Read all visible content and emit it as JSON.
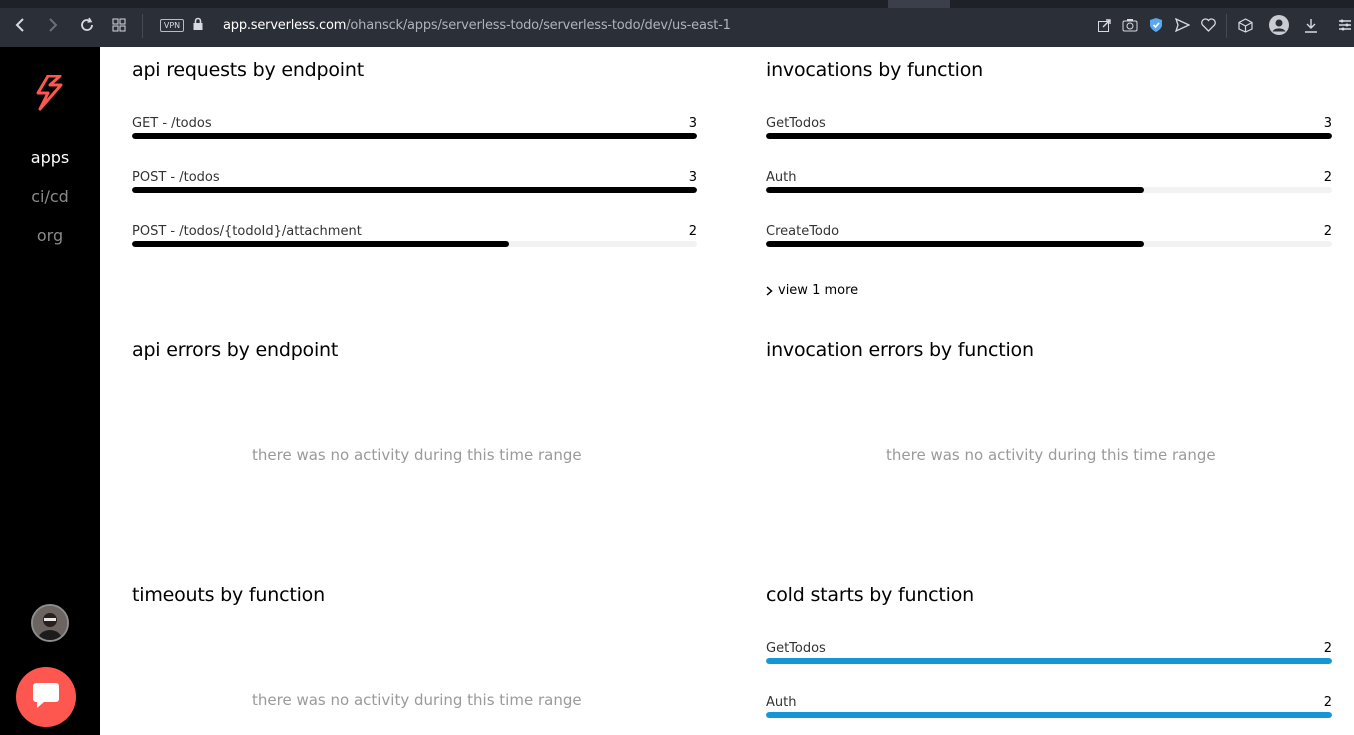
{
  "browser": {
    "vpn_label": "VPN",
    "url_host": "app.serverless.com",
    "url_path": "/ohansck/apps/serverless-todo/serverless-todo/dev/us-east-1"
  },
  "sidebar": {
    "items": [
      {
        "label": "apps",
        "active": true
      },
      {
        "label": "ci/cd",
        "active": false
      },
      {
        "label": "org",
        "active": false
      }
    ]
  },
  "panels": {
    "api_requests": {
      "title": "api requests by endpoint",
      "rows": [
        {
          "label": "GET - /todos",
          "value": "3",
          "fraction": 1.0
        },
        {
          "label": "POST - /todos",
          "value": "3",
          "fraction": 1.0
        },
        {
          "label": "POST - /todos/{todoId}/attachment",
          "value": "2",
          "fraction": 0.667
        }
      ]
    },
    "invocations": {
      "title": "invocations by function",
      "rows": [
        {
          "label": "GetTodos",
          "value": "3",
          "fraction": 1.0
        },
        {
          "label": "Auth",
          "value": "2",
          "fraction": 0.667
        },
        {
          "label": "CreateTodo",
          "value": "2",
          "fraction": 0.667
        }
      ],
      "view_more": "view 1 more"
    },
    "api_errors": {
      "title": "api errors by endpoint",
      "empty": "there was no activity during this time range"
    },
    "invocation_errors": {
      "title": "invocation errors by function",
      "empty": "there was no activity during this time range"
    },
    "timeouts": {
      "title": "timeouts by function",
      "empty": "there was no activity during this time range"
    },
    "cold_starts": {
      "title": "cold starts by function",
      "rows": [
        {
          "label": "GetTodos",
          "value": "2",
          "fraction": 1.0
        },
        {
          "label": "Auth",
          "value": "2",
          "fraction": 1.0
        }
      ]
    }
  },
  "colors": {
    "sidebar_bg": "#000000",
    "bar_default": "#000000",
    "bar_cold_start": "#1596d6",
    "chat_button": "#fd5750",
    "logo": "#fd5750"
  }
}
